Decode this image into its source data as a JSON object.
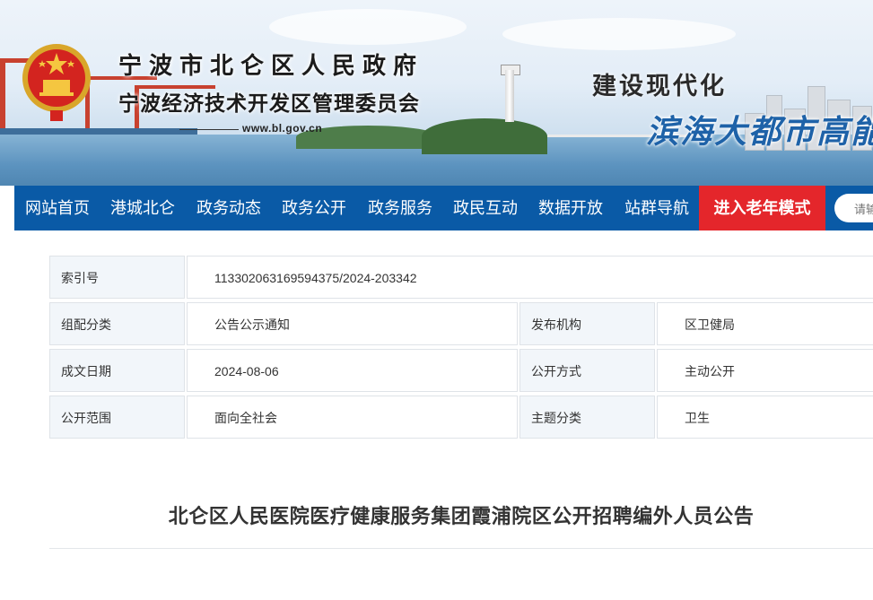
{
  "header": {
    "gov_name": "宁波市北仑区人民政府",
    "committee_name": "宁波经济技术开发区管理委员会",
    "url": "www.bl.gov.cn",
    "slogan_line1": "建设现代化",
    "slogan_line2": "滨海大都市高能"
  },
  "nav": {
    "items": [
      "网站首页",
      "港城北仑",
      "政务动态",
      "政务公开",
      "政务服务",
      "政民互动",
      "数据开放",
      "站群导航"
    ],
    "elder_mode": "进入老年模式",
    "search_placeholder": "请输"
  },
  "meta": {
    "index_label": "索引号",
    "index_value": "113302063169594375/2024-203342",
    "category_label": "组配分类",
    "category_value": "公告公示通知",
    "publisher_label": "发布机构",
    "publisher_value": "区卫健局",
    "date_label": "成文日期",
    "date_value": "2024-08-06",
    "open_mode_label": "公开方式",
    "open_mode_value": "主动公开",
    "scope_label": "公开范围",
    "scope_value": "面向全社会",
    "topic_label": "主题分类",
    "topic_value": "卫生"
  },
  "article": {
    "title": "北仑区人民医院医疗健康服务集团霞浦院区公开招聘编外人员公告"
  },
  "colors": {
    "nav_bg": "#0a5aa6",
    "elder_bg": "#e4262b",
    "label_bg": "#f2f6fa",
    "slogan_blue": "#1e62a8"
  }
}
